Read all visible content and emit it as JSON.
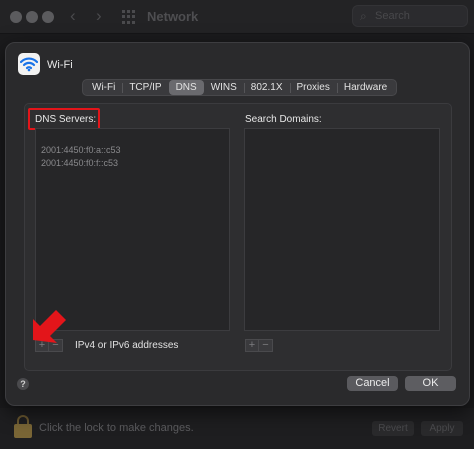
{
  "background": {
    "window_title": "Network",
    "search_placeholder": "Search",
    "lock_text": "Click the lock to make changes.",
    "revert_label": "Revert",
    "apply_label": "Apply"
  },
  "sheet": {
    "title": "Wi-Fi",
    "tabs": [
      {
        "label": "Wi-Fi",
        "active": false
      },
      {
        "label": "TCP/IP",
        "active": false
      },
      {
        "label": "DNS",
        "active": true
      },
      {
        "label": "WINS",
        "active": false
      },
      {
        "label": "802.1X",
        "active": false
      },
      {
        "label": "Proxies",
        "active": false
      },
      {
        "label": "Hardware",
        "active": false
      }
    ],
    "dns_servers": {
      "label": "DNS Servers:",
      "items": [
        "2001:4450:f0:a::c53",
        "2001:4450:f0:f::c53"
      ]
    },
    "search_domains": {
      "label": "Search Domains:",
      "items": []
    },
    "plus_label": "+",
    "minus_label": "−",
    "address_hint": "IPv4 or IPv6 addresses",
    "help_label": "?",
    "cancel_label": "Cancel",
    "ok_label": "OK"
  },
  "colors": {
    "highlight_border": "#e3151a",
    "arrow": "#e3151a",
    "sheet_bg": "#2a2a2c"
  }
}
